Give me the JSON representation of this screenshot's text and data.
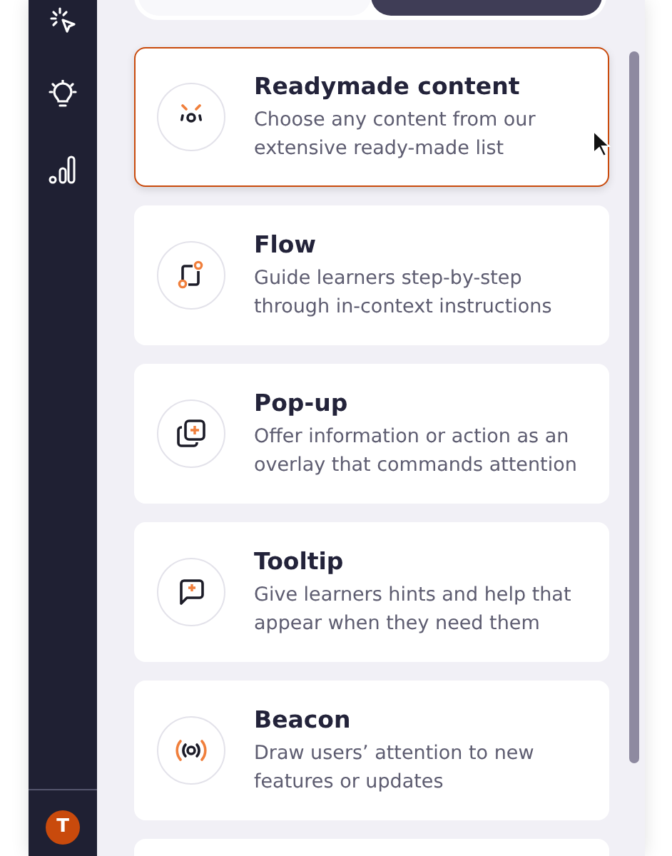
{
  "sidebar": {
    "items": [
      {
        "kind": "cursor"
      },
      {
        "kind": "bulb"
      },
      {
        "kind": "chart"
      }
    ],
    "avatar": {
      "initial": "T"
    }
  },
  "segmented": [
    {
      "selected": false
    },
    {
      "selected": true
    }
  ],
  "content_types": [
    {
      "kind": "readymade",
      "title": "Readymade content",
      "description": "Choose any content from our extensive ready-made list",
      "selected": true
    },
    {
      "kind": "flow",
      "title": "Flow",
      "description": "Guide learners step-by-step through in-context instructions",
      "selected": false
    },
    {
      "kind": "popup",
      "title": "Pop-up",
      "description": "Offer information or action as an overlay that commands attention",
      "selected": false
    },
    {
      "kind": "tooltip",
      "title": "Tooltip",
      "description": "Give learners hints and help that appear when they need them",
      "selected": false
    },
    {
      "kind": "beacon",
      "title": "Beacon",
      "description": "Draw users’ attention to new features or updates",
      "selected": false
    }
  ]
}
